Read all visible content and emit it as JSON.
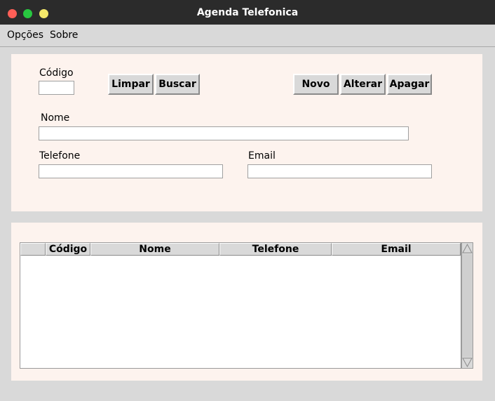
{
  "window": {
    "title": "Agenda Telefonica"
  },
  "menu": {
    "items": [
      "Opções",
      "Sobre"
    ]
  },
  "form": {
    "codigo_label": "Código",
    "nome_label": "Nome",
    "telefone_label": "Telefone",
    "email_label": "Email",
    "codigo_value": "",
    "nome_value": "",
    "telefone_value": "",
    "email_value": ""
  },
  "buttons": {
    "limpar": "Limpar",
    "buscar": "Buscar",
    "novo": "Novo",
    "alterar": "Alterar",
    "apagar": "Apagar"
  },
  "table": {
    "columns": [
      "",
      "Código",
      "Nome",
      "Telefone",
      "Email"
    ],
    "rows": []
  },
  "colors": {
    "titlebar": "#2b2b2b",
    "panel": "#fdf3ee",
    "window_bg": "#d9d9d9",
    "close": "#ff5f57",
    "minimize": "#28c840",
    "maximize": "#f5e96a"
  }
}
